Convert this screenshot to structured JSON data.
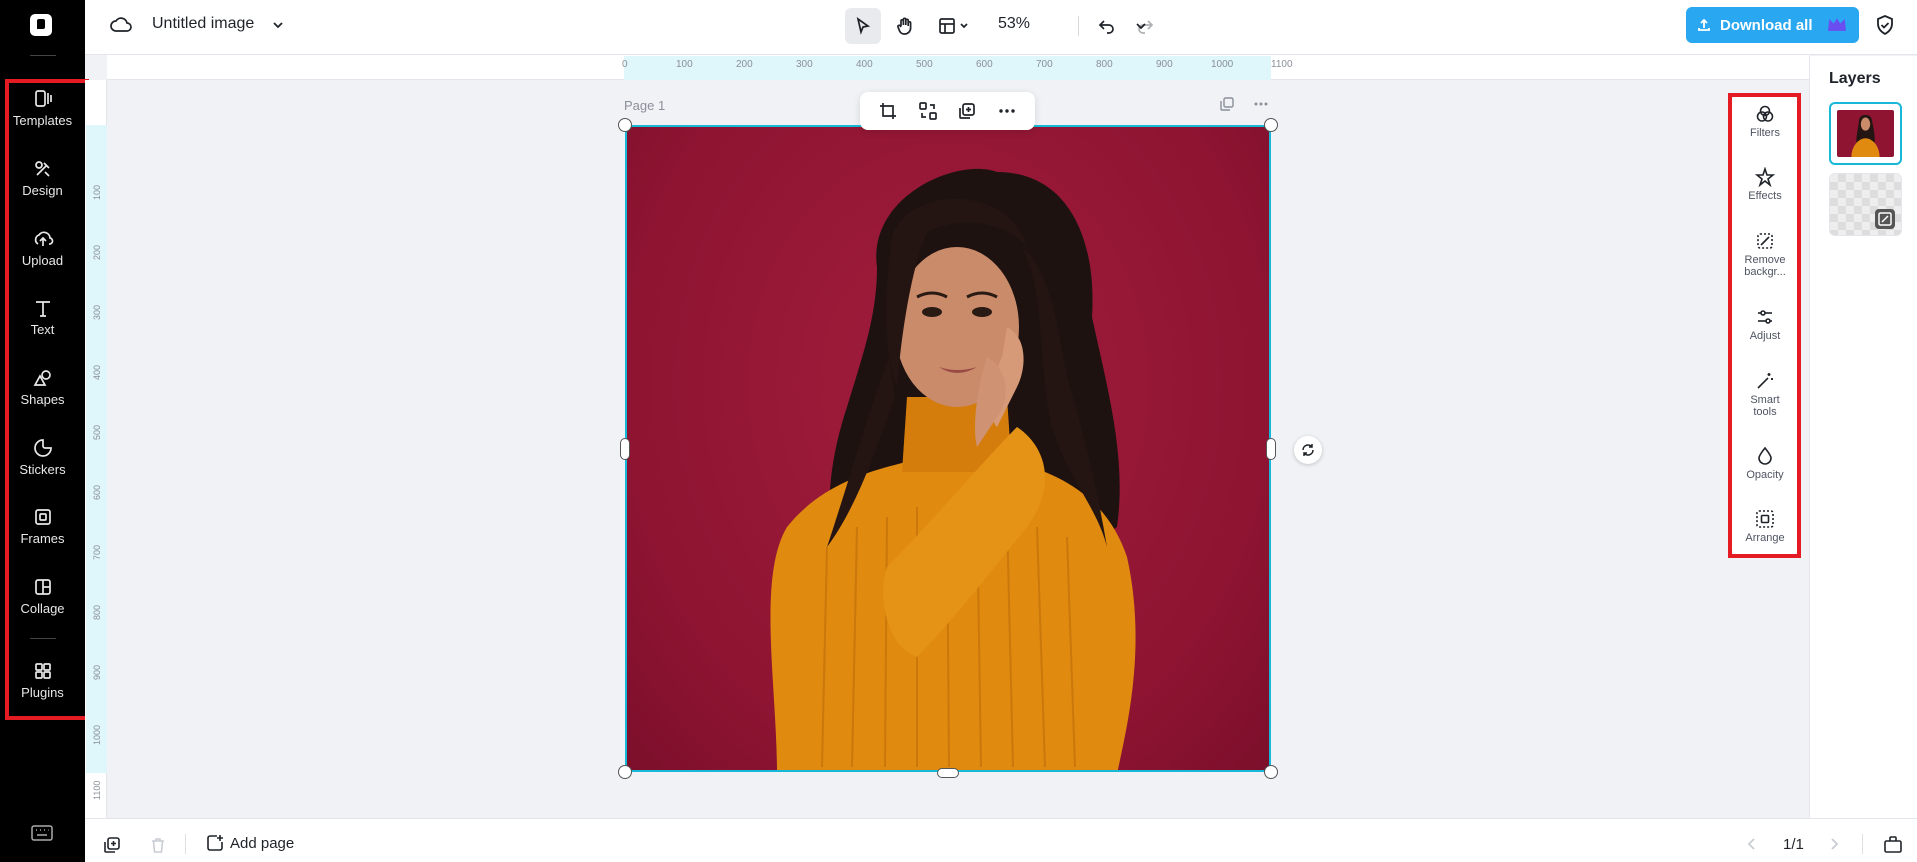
{
  "header": {
    "doc_title": "Untitled image",
    "zoom": "53%",
    "download_label": "Download all"
  },
  "sidebar": {
    "items": [
      {
        "label": "Templates",
        "icon": "templates-icon"
      },
      {
        "label": "Design",
        "icon": "design-icon"
      },
      {
        "label": "Upload",
        "icon": "upload-icon"
      },
      {
        "label": "Text",
        "icon": "text-icon"
      },
      {
        "label": "Shapes",
        "icon": "shapes-icon"
      },
      {
        "label": "Stickers",
        "icon": "stickers-icon"
      },
      {
        "label": "Frames",
        "icon": "frames-icon"
      },
      {
        "label": "Collage",
        "icon": "collage-icon"
      },
      {
        "label": "Plugins",
        "icon": "plugins-icon"
      }
    ]
  },
  "ruler": {
    "top_ticks": [
      "0",
      "100",
      "200",
      "300",
      "400",
      "500",
      "600",
      "700",
      "800",
      "900",
      "1000",
      "1100"
    ],
    "left_ticks": [
      "100",
      "200",
      "300",
      "400",
      "500",
      "600",
      "700",
      "800",
      "900",
      "1000",
      "1100"
    ]
  },
  "canvas": {
    "page_label": "Page 1"
  },
  "context_panel": {
    "items": [
      {
        "label": "Filters",
        "icon": "filters-icon"
      },
      {
        "label": "Effects",
        "icon": "effects-icon"
      },
      {
        "label": "Remove backgr...",
        "icon": "remove-background-icon"
      },
      {
        "label": "Adjust",
        "icon": "adjust-icon"
      },
      {
        "label": "Smart tools",
        "icon": "smart-tools-icon"
      },
      {
        "label": "Opacity",
        "icon": "opacity-icon"
      },
      {
        "label": "Arrange",
        "icon": "arrange-icon"
      }
    ]
  },
  "layers": {
    "title": "Layers"
  },
  "footer": {
    "add_page_label": "Add page",
    "page_count": "1/1"
  },
  "colors": {
    "accent": "#29a7f0",
    "selection": "#17b8d8",
    "highlight_box": "#e41b23",
    "photo_bg": "#8e1432",
    "sweater": "#e08a10"
  }
}
